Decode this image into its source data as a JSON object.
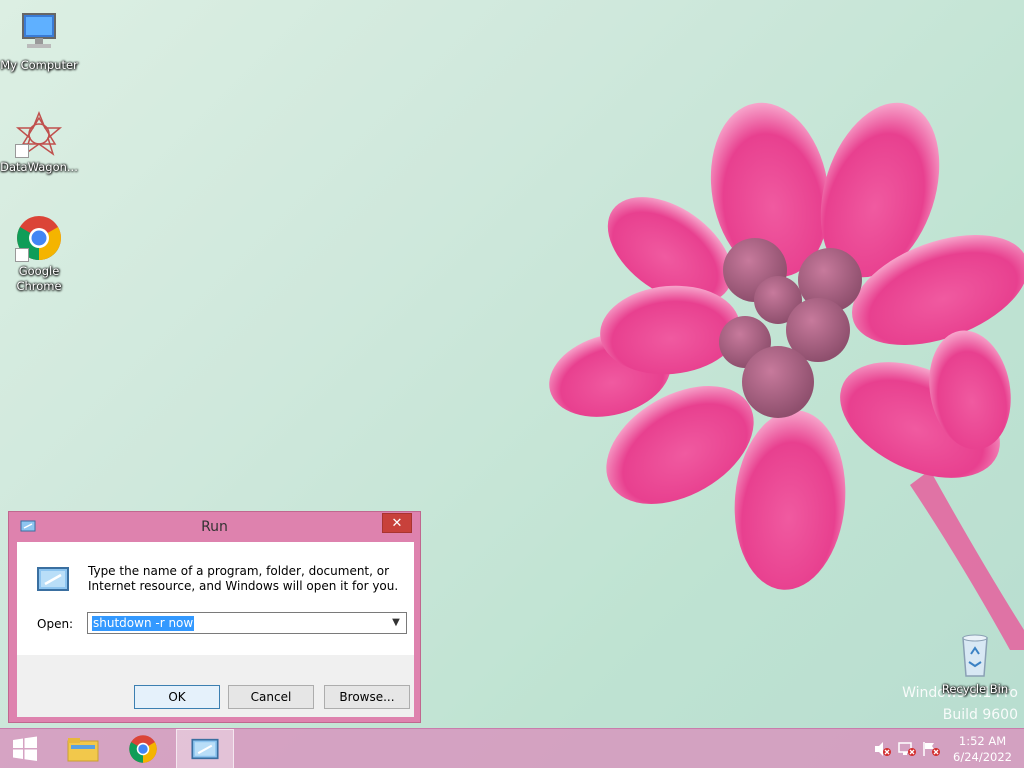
{
  "desktop": {
    "icons": [
      {
        "label": "My Computer",
        "icon": "computer-icon"
      },
      {
        "label": "DataWagon...",
        "icon": "datawagon-icon"
      },
      {
        "label": "Google Chrome",
        "icon": "chrome-icon"
      },
      {
        "label": "Recycle Bin",
        "icon": "recycle-bin-icon"
      }
    ],
    "watermark": {
      "line1": "Windows 8.1 Pro",
      "line2": "Build 9600"
    }
  },
  "run_dialog": {
    "title": "Run",
    "close_label": "✕",
    "description": "Type the name of a program, folder, document, or Internet resource, and Windows will open it for you.",
    "open_label": "Open:",
    "open_value": "shutdown -r now",
    "ok_label": "OK",
    "cancel_label": "Cancel",
    "browse_label": "Browse..."
  },
  "taskbar": {
    "items": [
      "start-button",
      "file-explorer",
      "google-chrome",
      "run"
    ],
    "clock": {
      "time": "1:52 AM",
      "date": "6/24/2022"
    },
    "tray": [
      "volume-muted-icon",
      "network-icon",
      "action-center-flag-icon"
    ]
  },
  "colors": {
    "accent": "#de82ae",
    "taskbar": "#d796be",
    "selection": "#3399ff",
    "close": "#c8413b"
  }
}
